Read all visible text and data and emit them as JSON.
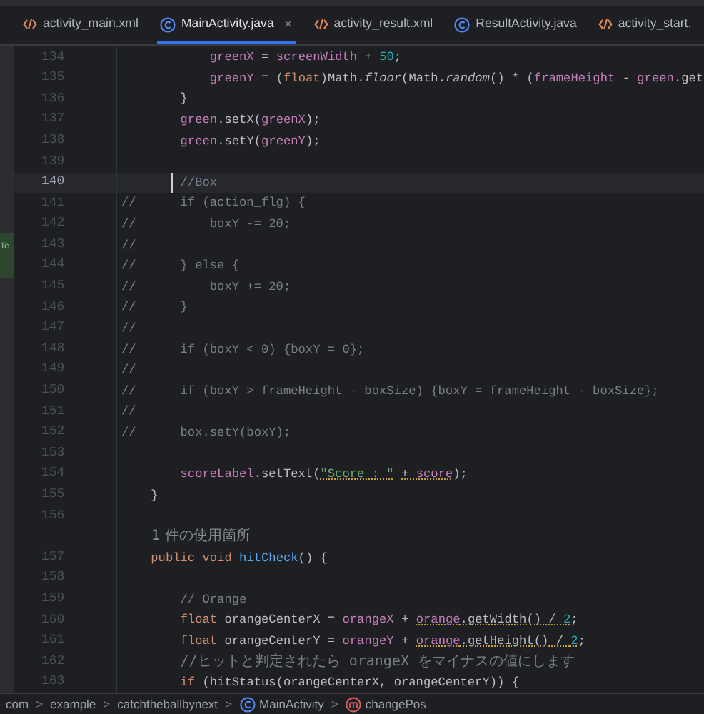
{
  "tabs": [
    {
      "label": "activity_main.xml",
      "kind": "xml",
      "selected": false
    },
    {
      "label": "MainActivity.java",
      "kind": "class",
      "selected": true,
      "close": "×"
    },
    {
      "label": "activity_result.xml",
      "kind": "xml",
      "selected": false
    },
    {
      "label": "ResultActivity.java",
      "kind": "class",
      "selected": false
    },
    {
      "label": "activity_start.",
      "kind": "xml",
      "selected": false
    }
  ],
  "side_panel": {
    "label": "Te"
  },
  "lines": [
    {
      "kind": "code",
      "number": "134",
      "current": false,
      "tokens": [
        {
          "kind": "field",
          "text": "            greenX",
          "warn": false
        },
        {
          "kind": "plain",
          "text": " = ",
          "warn": false
        },
        {
          "kind": "field",
          "text": "screenWidth",
          "warn": false
        },
        {
          "kind": "plain",
          "text": " + ",
          "warn": false
        },
        {
          "kind": "number",
          "text": "50",
          "warn": false
        },
        {
          "kind": "plain",
          "text": ";",
          "warn": false
        }
      ]
    },
    {
      "kind": "code",
      "number": "135",
      "current": false,
      "tokens": [
        {
          "kind": "field",
          "text": "            greenY",
          "warn": false
        },
        {
          "kind": "plain",
          "text": " = (",
          "warn": false
        },
        {
          "kind": "keyword",
          "text": "float",
          "warn": false
        },
        {
          "kind": "plain",
          "text": ")Math.",
          "warn": false
        },
        {
          "kind": "static",
          "text": "floor",
          "warn": false
        },
        {
          "kind": "plain",
          "text": "(Math.",
          "warn": false
        },
        {
          "kind": "static",
          "text": "random",
          "warn": false
        },
        {
          "kind": "plain",
          "text": "() * (",
          "warn": false
        },
        {
          "kind": "field",
          "text": "frameHeight",
          "warn": false
        },
        {
          "kind": "plain",
          "text": " - ",
          "warn": false
        },
        {
          "kind": "field",
          "text": "green",
          "warn": false
        },
        {
          "kind": "plain",
          "text": ".get",
          "warn": false
        }
      ]
    },
    {
      "kind": "code",
      "number": "136",
      "current": false,
      "tokens": [
        {
          "kind": "plain",
          "text": "        }",
          "warn": false
        }
      ]
    },
    {
      "kind": "code",
      "number": "137",
      "current": false,
      "tokens": [
        {
          "kind": "field",
          "text": "        green",
          "warn": false
        },
        {
          "kind": "plain",
          "text": ".setX(",
          "warn": false
        },
        {
          "kind": "field",
          "text": "greenX",
          "warn": false
        },
        {
          "kind": "plain",
          "text": ");",
          "warn": false
        }
      ]
    },
    {
      "kind": "code",
      "number": "138",
      "current": false,
      "tokens": [
        {
          "kind": "field",
          "text": "        green",
          "warn": false
        },
        {
          "kind": "plain",
          "text": ".setY(",
          "warn": false
        },
        {
          "kind": "field",
          "text": "greenY",
          "warn": false
        },
        {
          "kind": "plain",
          "text": ");",
          "warn": false
        }
      ]
    },
    {
      "kind": "code",
      "number": "139",
      "current": false
    },
    {
      "kind": "code",
      "number": "140",
      "current": true,
      "tokens": [
        {
          "kind": "comment",
          "text": "        //Box",
          "warn": false
        }
      ]
    },
    {
      "kind": "code",
      "number": "141",
      "current": false,
      "tokens": [
        {
          "kind": "comment",
          "text": "//      if (action_flg) {",
          "warn": false
        }
      ]
    },
    {
      "kind": "code",
      "number": "142",
      "current": false,
      "tokens": [
        {
          "kind": "comment",
          "text": "//          boxY -= 20;",
          "warn": false
        }
      ]
    },
    {
      "kind": "code",
      "number": "143",
      "current": false,
      "tokens": [
        {
          "kind": "comment",
          "text": "//",
          "warn": false
        }
      ]
    },
    {
      "kind": "code",
      "number": "144",
      "current": false,
      "tokens": [
        {
          "kind": "comment",
          "text": "//      } else {",
          "warn": false
        }
      ]
    },
    {
      "kind": "code",
      "number": "145",
      "current": false,
      "tokens": [
        {
          "kind": "comment",
          "text": "//          boxY += 20;",
          "warn": false
        }
      ]
    },
    {
      "kind": "code",
      "number": "146",
      "current": false,
      "tokens": [
        {
          "kind": "comment",
          "text": "//      }",
          "warn": false
        }
      ]
    },
    {
      "kind": "code",
      "number": "147",
      "current": false,
      "tokens": [
        {
          "kind": "comment",
          "text": "//",
          "warn": false
        }
      ]
    },
    {
      "kind": "code",
      "number": "148",
      "current": false,
      "tokens": [
        {
          "kind": "comment",
          "text": "//      if (boxY < 0) {boxY = 0};",
          "warn": false
        }
      ]
    },
    {
      "kind": "code",
      "number": "149",
      "current": false,
      "tokens": [
        {
          "kind": "comment",
          "text": "//",
          "warn": false
        }
      ]
    },
    {
      "kind": "code",
      "number": "150",
      "current": false,
      "tokens": [
        {
          "kind": "comment",
          "text": "//      if (boxY > frameHeight - boxSize) {boxY = frameHeight - boxSize};",
          "warn": false
        }
      ]
    },
    {
      "kind": "code",
      "number": "151",
      "current": false,
      "tokens": [
        {
          "kind": "comment",
          "text": "//",
          "warn": false
        }
      ]
    },
    {
      "kind": "code",
      "number": "152",
      "current": false,
      "tokens": [
        {
          "kind": "comment",
          "text": "//      box.setY(boxY);",
          "warn": false
        }
      ]
    },
    {
      "kind": "code",
      "number": "153",
      "current": false
    },
    {
      "kind": "code",
      "number": "154",
      "current": false,
      "tokens": [
        {
          "kind": "field",
          "text": "        scoreLabel",
          "warn": false
        },
        {
          "kind": "plain",
          "text": ".setText(",
          "warn": false
        },
        {
          "kind": "string",
          "text": "\"Score : \"",
          "warn": true
        },
        {
          "kind": "plain",
          "text": " + ",
          "warn": true
        },
        {
          "kind": "field",
          "text": "score",
          "warn": true
        },
        {
          "kind": "plain",
          "text": ");",
          "warn": false
        }
      ]
    },
    {
      "kind": "code",
      "number": "155",
      "current": false,
      "tokens": [
        {
          "kind": "plain",
          "text": "    }",
          "warn": false
        }
      ]
    },
    {
      "kind": "code",
      "number": "156",
      "current": false
    },
    {
      "kind": "hint",
      "text": "1 件の使用箇所"
    },
    {
      "kind": "code",
      "number": "157",
      "current": false,
      "tokens": [
        {
          "kind": "keyword",
          "text": "    public void ",
          "warn": false
        },
        {
          "kind": "method",
          "text": "hitCheck",
          "warn": false
        },
        {
          "kind": "plain",
          "text": "() {",
          "warn": false
        }
      ]
    },
    {
      "kind": "code",
      "number": "158",
      "current": false
    },
    {
      "kind": "code",
      "number": "159",
      "current": false,
      "tokens": [
        {
          "kind": "comment",
          "text": "        // Orange",
          "warn": false
        }
      ]
    },
    {
      "kind": "code",
      "number": "160",
      "current": false,
      "tokens": [
        {
          "kind": "keyword",
          "text": "        float ",
          "warn": false
        },
        {
          "kind": "plain",
          "text": "orangeCenterX = ",
          "warn": false
        },
        {
          "kind": "field",
          "text": "orangeX",
          "warn": false
        },
        {
          "kind": "plain",
          "text": " + ",
          "warn": false
        },
        {
          "kind": "field",
          "text": "orange",
          "warn": true
        },
        {
          "kind": "plain",
          "text": ".getWidth() / ",
          "warn": true
        },
        {
          "kind": "number",
          "text": "2",
          "warn": true
        },
        {
          "kind": "plain",
          "text": ";",
          "warn": false
        }
      ]
    },
    {
      "kind": "code",
      "number": "161",
      "current": false,
      "tokens": [
        {
          "kind": "keyword",
          "text": "        float ",
          "warn": false
        },
        {
          "kind": "plain",
          "text": "orangeCenterY = ",
          "warn": false
        },
        {
          "kind": "field",
          "text": "orangeY",
          "warn": false
        },
        {
          "kind": "plain",
          "text": " + ",
          "warn": false
        },
        {
          "kind": "field",
          "text": "orange",
          "warn": true
        },
        {
          "kind": "plain",
          "text": ".getHeight() / ",
          "warn": true
        },
        {
          "kind": "number",
          "text": "2",
          "warn": true
        },
        {
          "kind": "plain",
          "text": ";",
          "warn": false
        }
      ]
    },
    {
      "kind": "code",
      "number": "162",
      "current": false,
      "tokens": [
        {
          "kind": "comment",
          "text": "        //ヒットと判定されたら orangeX をマイナスの値にします",
          "warn": false
        }
      ]
    },
    {
      "kind": "code",
      "number": "163",
      "current": false,
      "tokens": [
        {
          "kind": "keyword",
          "text": "        if ",
          "warn": false
        },
        {
          "kind": "plain",
          "text": "(hitStatus(orangeCenterX, orangeCenterY)) {",
          "warn": false
        }
      ]
    }
  ],
  "breadcrumbs": {
    "separator": ">",
    "items": [
      {
        "label": "com",
        "kind": "package"
      },
      {
        "label": "example",
        "kind": "package"
      },
      {
        "label": "catchtheballbynext",
        "kind": "package"
      },
      {
        "label": "MainActivity",
        "kind": "class"
      },
      {
        "label": "changePos",
        "kind": "method"
      }
    ]
  }
}
